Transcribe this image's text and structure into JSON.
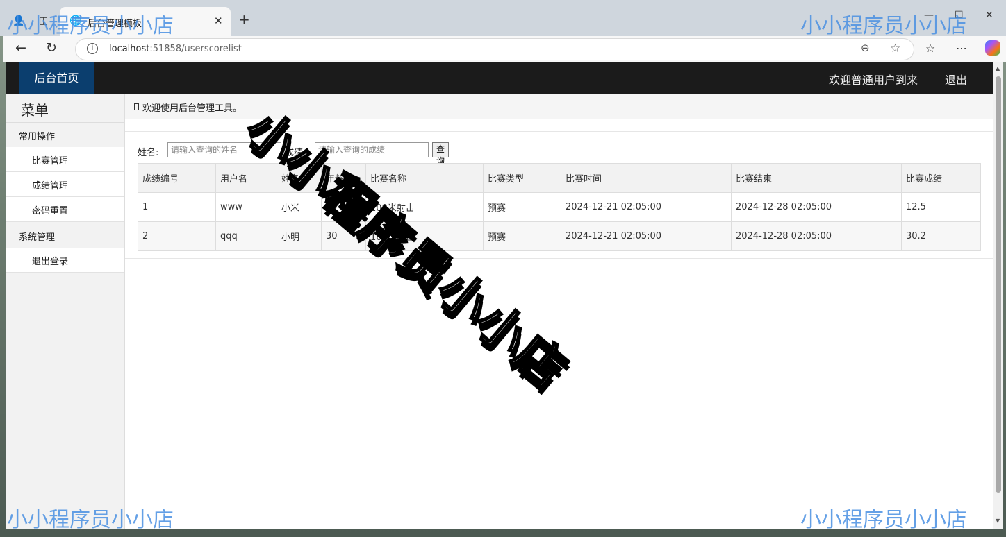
{
  "browser": {
    "tab_title": "后台管理模板",
    "url_host": "localhost",
    "url_path": ":51858/userscorelist"
  },
  "header": {
    "home": "后台首页",
    "welcome": "欢迎普通用户到来",
    "logout": "退出"
  },
  "sidebar": {
    "title": "菜单",
    "group1": "常用操作",
    "items1": [
      "比赛管理",
      "成绩管理",
      "密码重置"
    ],
    "group2": "系统管理",
    "items2": [
      "退出登录"
    ]
  },
  "breadcrumb": "欢迎使用后台管理工具。",
  "search": {
    "name_label": "姓名:",
    "name_placeholder": "请输入查询的姓名",
    "score_label": "成绩:",
    "score_placeholder": "请输入查询的成绩",
    "button": "查询"
  },
  "table": {
    "headers": [
      "成绩编号",
      "用户名",
      "姓名",
      "年龄",
      "比赛名称",
      "比赛类型",
      "比赛时间",
      "比赛结束",
      "比赛成绩"
    ],
    "rows": [
      [
        "1",
        "www",
        "小米",
        "20",
        "100米射击",
        "预赛",
        "2024-12-21 02:05:00",
        "2024-12-28 02:05:00",
        "12.5"
      ],
      [
        "2",
        "qqq",
        "小明",
        "30",
        "100米射击",
        "预赛",
        "2024-12-21 02:05:00",
        "2024-12-28 02:05:00",
        "30.2"
      ]
    ]
  },
  "watermark": "小小程序员小小店"
}
